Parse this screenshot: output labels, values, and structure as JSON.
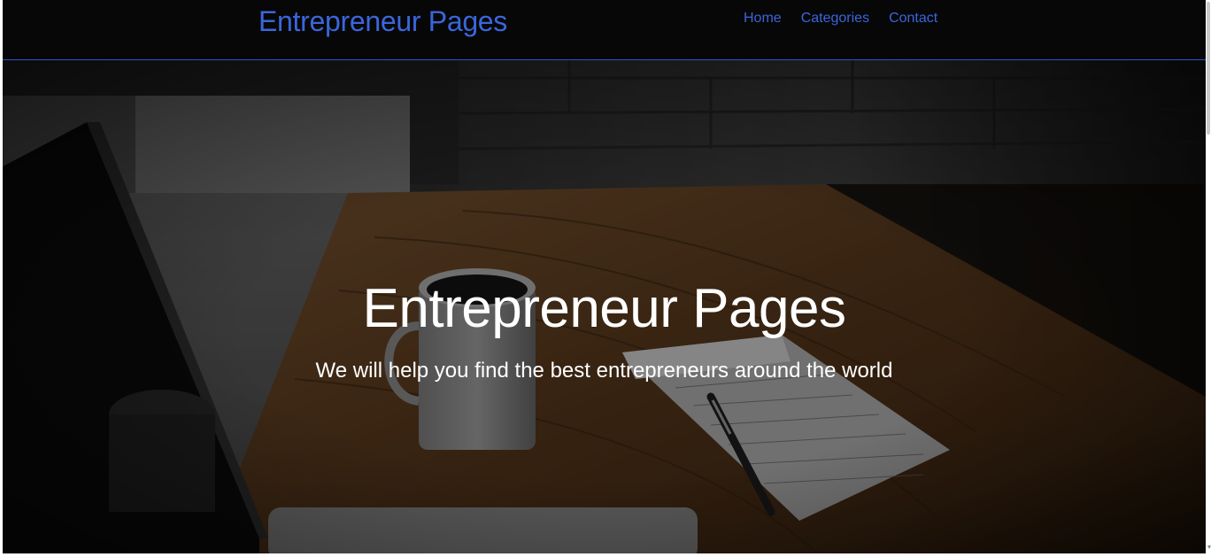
{
  "navbar": {
    "brand": "Entrepreneur Pages",
    "links": [
      "Home",
      "Categories",
      "Contact"
    ]
  },
  "hero": {
    "title": "Entrepreneur Pages",
    "subtitle": "We will help you find the best entrepreneurs around the world"
  },
  "colors": {
    "accent": "#3a66dc",
    "nav_background": "#070707"
  }
}
